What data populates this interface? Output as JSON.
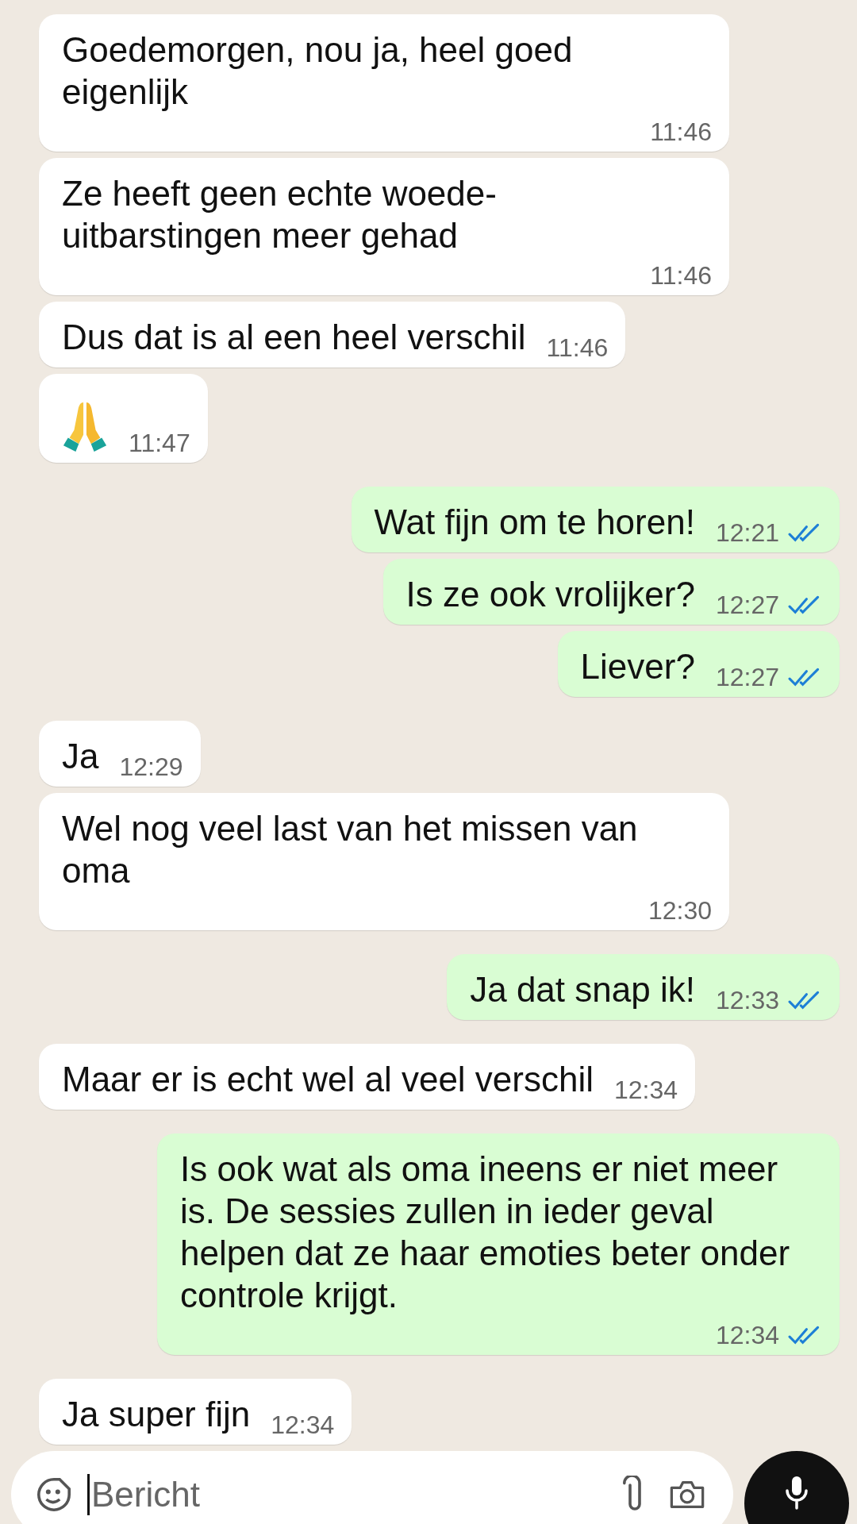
{
  "messages": [
    {
      "kind": "text",
      "outgoing": false,
      "text": "Goedemorgen, nou ja, heel goed eigenlijk",
      "time": "11:46"
    },
    {
      "kind": "text",
      "outgoing": false,
      "text": "Ze heeft geen echte woede-uitbarstingen meer gehad",
      "time": "11:46"
    },
    {
      "kind": "text",
      "outgoing": false,
      "text": "Dus dat is al een heel verschil",
      "time": "11:46"
    },
    {
      "kind": "emoji",
      "outgoing": false,
      "time": "11:47"
    },
    {
      "kind": "text",
      "outgoing": true,
      "text": "Wat fijn om te horen!",
      "time": "12:21",
      "read": true
    },
    {
      "kind": "text",
      "outgoing": true,
      "text": "Is ze ook vrolijker?",
      "time": "12:27",
      "read": true
    },
    {
      "kind": "text",
      "outgoing": true,
      "text": "Liever?",
      "time": "12:27",
      "read": true
    },
    {
      "kind": "text",
      "outgoing": false,
      "text": "Ja",
      "time": "12:29"
    },
    {
      "kind": "text",
      "outgoing": false,
      "text": "Wel nog veel last van het missen van oma",
      "time": "12:30"
    },
    {
      "kind": "text",
      "outgoing": true,
      "text": "Ja dat snap ik!",
      "time": "12:33",
      "read": true
    },
    {
      "kind": "text",
      "outgoing": false,
      "text": "Maar er is echt wel al veel verschil",
      "time": "12:34"
    },
    {
      "kind": "text",
      "outgoing": true,
      "text": "Is ook wat als oma ineens er niet meer is. De sessies zullen in ieder geval helpen dat ze haar emoties beter onder controle krijgt.",
      "time": "12:34",
      "read": true
    },
    {
      "kind": "text",
      "outgoing": false,
      "text": "Ja super fijn",
      "time": "12:34"
    }
  ],
  "composer": {
    "placeholder": "Bericht"
  }
}
